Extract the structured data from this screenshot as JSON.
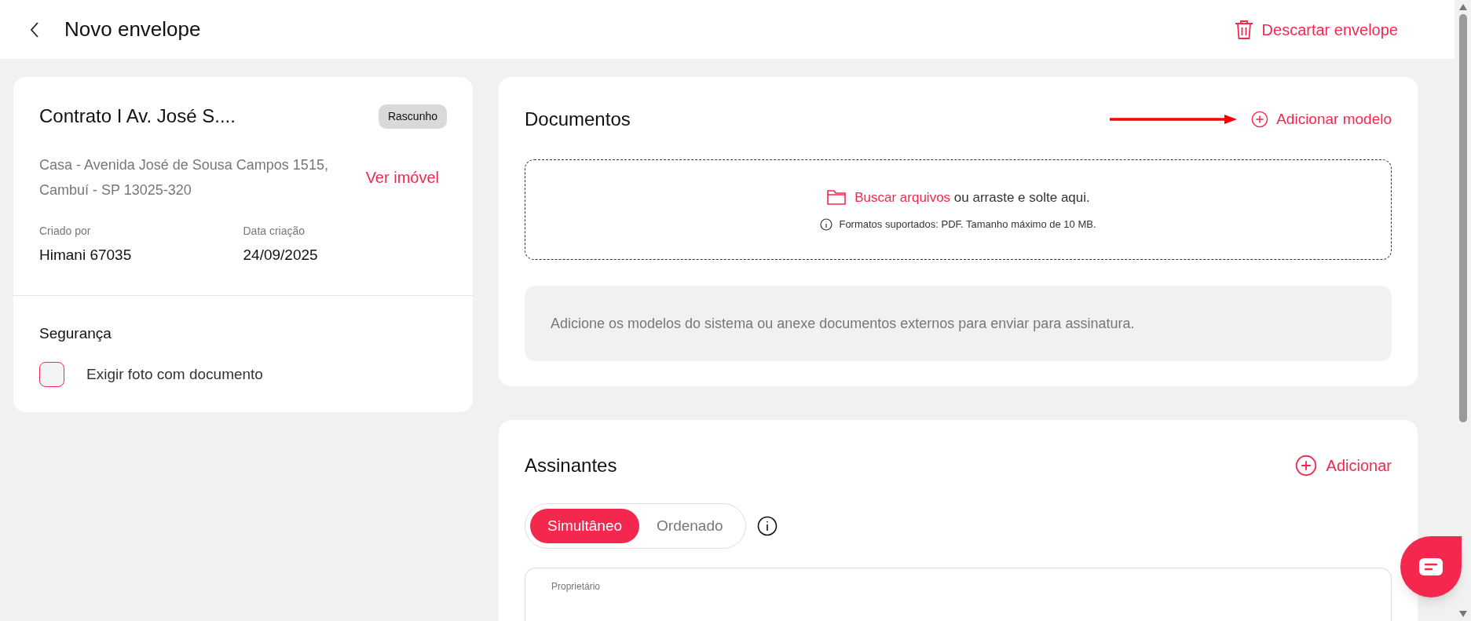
{
  "header": {
    "title": "Novo envelope",
    "discard_label": "Descartar envelope"
  },
  "envelope": {
    "title": "Contrato I Av. José S....",
    "status": "Rascunho",
    "address": "Casa - Avenida José de Sousa Campos 1515, Cambuí - SP 13025-320",
    "view_link": "Ver imóvel",
    "fields": [
      {
        "label": "Criado por",
        "value": "Himani 67035"
      },
      {
        "label": "Data criação",
        "value": "24/09/2025"
      }
    ],
    "security": {
      "title": "Segurança",
      "options": [
        {
          "label": "Exigir foto com documento",
          "checked": false
        }
      ]
    }
  },
  "documents": {
    "title": "Documentos",
    "add_label": "Adicionar modelo",
    "dropzone": {
      "link": "Buscar arquivos",
      "text": "ou arraste e solte aqui.",
      "hint": "Formatos suportados: PDF. Tamanho máximo de 10 MB."
    },
    "empty_message": "Adicione os modelos do sistema ou anexe documentos externos para enviar para assinatura."
  },
  "signers": {
    "title": "Assinantes",
    "add_label": "Adicionar",
    "modes": [
      {
        "label": "Simultâneo",
        "selected": true
      },
      {
        "label": "Ordenado",
        "selected": false
      }
    ],
    "first_card_label": "Proprietário"
  }
}
